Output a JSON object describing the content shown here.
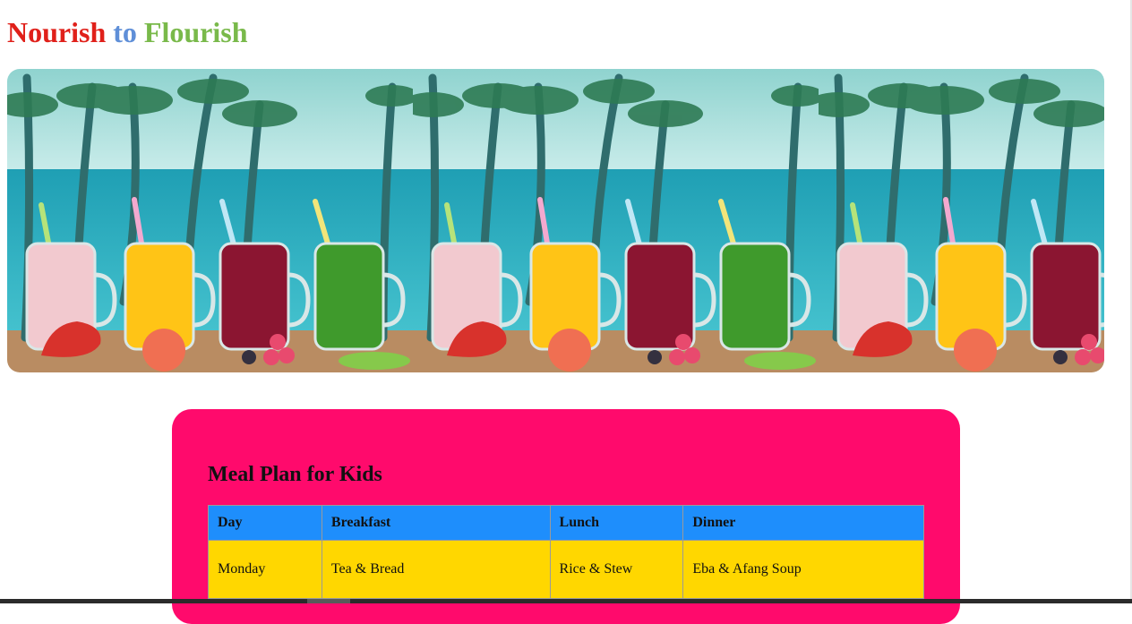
{
  "header": {
    "title_parts": [
      {
        "text": "Nourish",
        "color": "#e0201a"
      },
      {
        "text": " to ",
        "color": "#5f8fd8"
      },
      {
        "text": "Flourish",
        "color": "#79b94a"
      }
    ]
  },
  "banner": {
    "image": "smoothie-jars-beach-photo",
    "repeat_count": 3
  },
  "meal_plan": {
    "background": "#ff0a6c",
    "heading": "Meal Plan for Kids",
    "header_color": "#1e8efc",
    "row_color": "#ffd700",
    "columns": [
      "Day",
      "Breakfast",
      "Lunch",
      "Dinner"
    ],
    "rows": [
      [
        "Monday",
        "Tea & Bread",
        "Rice & Stew",
        "Eba & Afang Soup"
      ]
    ]
  }
}
